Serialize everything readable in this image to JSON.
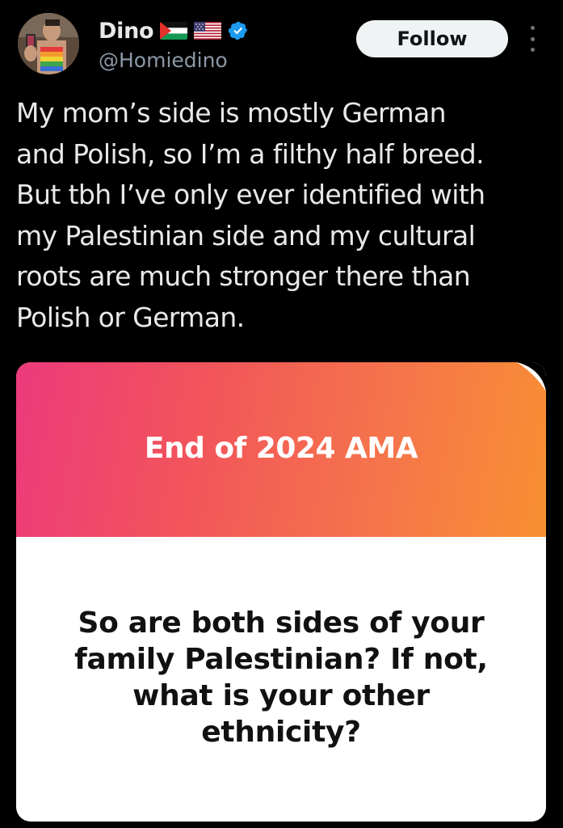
{
  "user": {
    "display_name": "Dino",
    "handle": "@Homiedino",
    "flags": [
      "palestine-flag-icon",
      "usa-flag-icon"
    ],
    "verified": true
  },
  "actions": {
    "follow_label": "Follow"
  },
  "tweet": {
    "text": "My mom’s side is mostly German\nand Polish, so I’m a filthy half breed.\nBut tbh I’ve only ever identified with\nmy Palestinian side and my cultural\nroots are much stronger there than\nPolish or German."
  },
  "media": {
    "banner_title": "End of 2024 AMA",
    "question": "So are both sides of your family Palestinian? If not, what is your other ethnicity?"
  },
  "colors": {
    "background": "#000000",
    "text_primary": "#e7e9ea",
    "text_secondary": "#8b98a5",
    "verified_blue": "#1d9bf0",
    "banner_gradient_start": "#ec3a7c",
    "banner_gradient_end": "#f89032"
  }
}
